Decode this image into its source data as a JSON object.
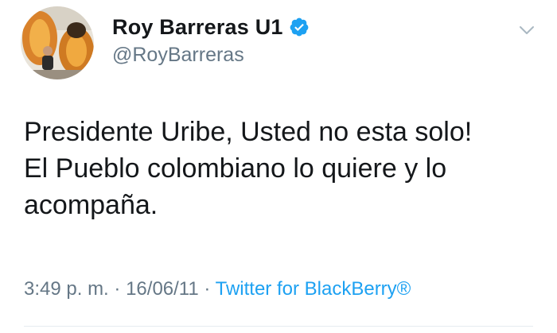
{
  "user": {
    "display_name": "Roy Barreras U1",
    "handle": "@RoyBarreras",
    "verified": true,
    "avatar_icon": "profile-avatar"
  },
  "tweet": {
    "lines": [
      "Presidente Uribe, Usted no esta solo!",
      "El Pueblo colombiano lo quiere y lo",
      "acompaña."
    ]
  },
  "meta": {
    "time": "3:49 p. m.",
    "separator": "·",
    "date": "16/06/11",
    "source": "Twitter for BlackBerry®"
  },
  "icons": {
    "verified": "verified-badge-icon",
    "menu": "chevron-down-icon"
  },
  "colors": {
    "text": "#14171a",
    "secondary": "#657786",
    "accent": "#1da1f2"
  }
}
